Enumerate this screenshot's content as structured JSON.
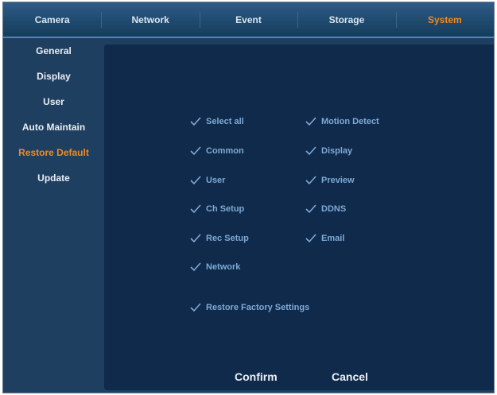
{
  "tabs": [
    {
      "label": "Camera"
    },
    {
      "label": "Network"
    },
    {
      "label": "Event"
    },
    {
      "label": "Storage"
    },
    {
      "label": "System",
      "active": true
    }
  ],
  "sidebar": {
    "items": [
      {
        "label": "General"
      },
      {
        "label": "Display"
      },
      {
        "label": "User"
      },
      {
        "label": "Auto Maintain"
      },
      {
        "label": "Restore Default",
        "active": true
      },
      {
        "label": "Update"
      }
    ]
  },
  "options": {
    "select_all": "Select all",
    "common": "Common",
    "user": "User",
    "ch_setup": "Ch Setup",
    "rec_setup": "Rec Setup",
    "network": "Network",
    "motion_detect": "Motion Detect",
    "display": "Display",
    "preview": "Preview",
    "ddns": "DDNS",
    "email": "Email",
    "restore_factory": "Restore Factory Settings"
  },
  "buttons": {
    "confirm": "Confirm",
    "cancel": "Cancel"
  },
  "colors": {
    "accent": "#f08c1e",
    "option_text": "#7fa9d6",
    "panel_bg": "#0f2a4a",
    "frame_bg": "#1f3f60"
  }
}
